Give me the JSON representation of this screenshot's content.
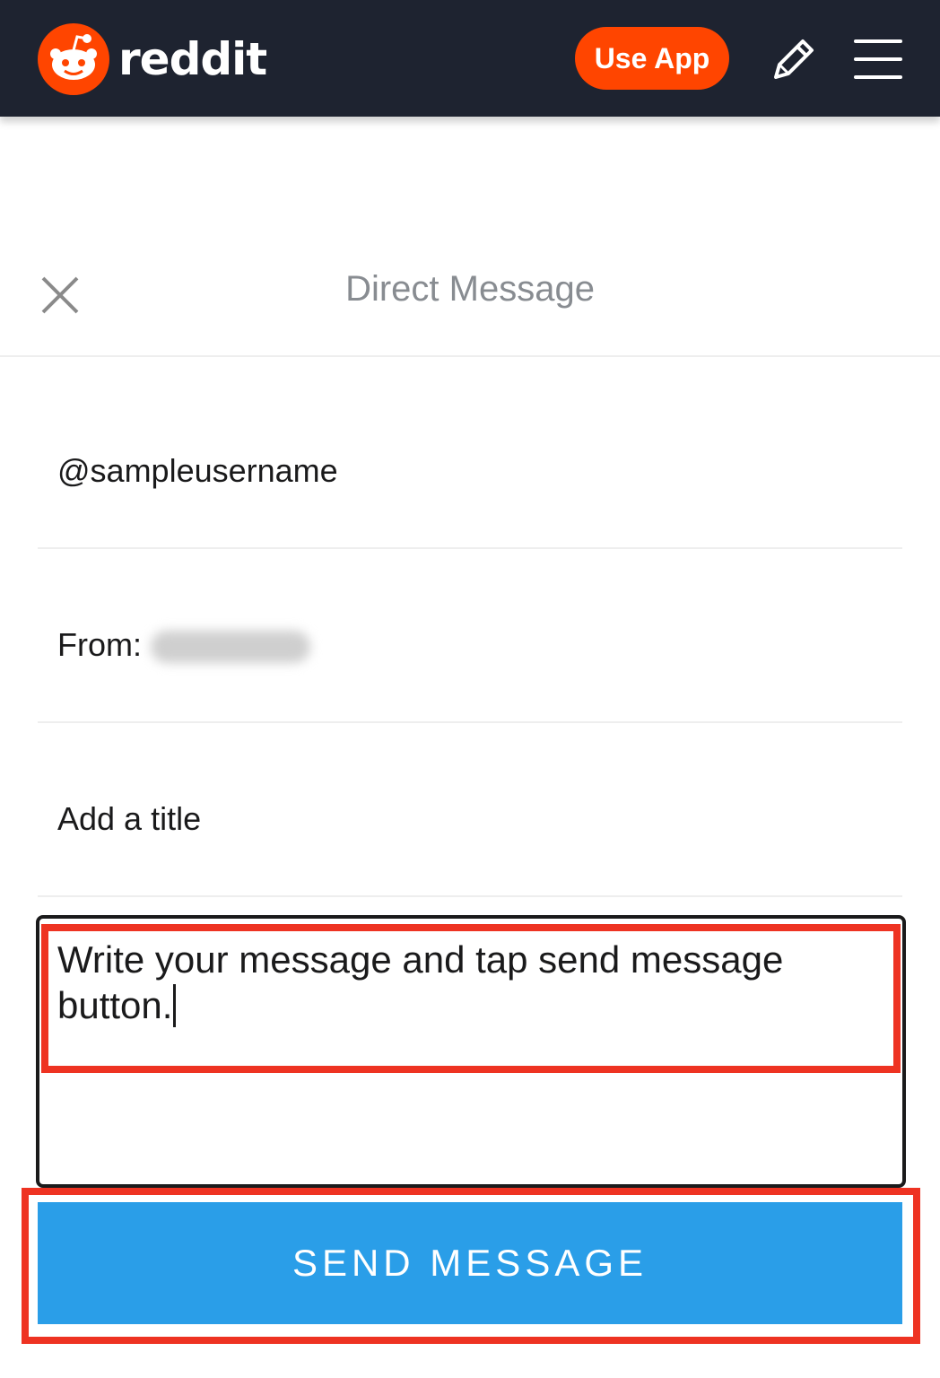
{
  "header": {
    "logo_text": "reddit",
    "use_app_label": "Use App",
    "brand_color": "#ff4500",
    "bar_color": "#1e2330",
    "icons": [
      "reddit-snoo-icon",
      "pencil-icon",
      "hamburger-menu-icon"
    ]
  },
  "dialog": {
    "title": "Direct Message",
    "close_icon": "close-icon",
    "to_value": "@sampleusername",
    "from_label": "From:",
    "title_placeholder": "Add a title",
    "message_value": "Write your message and tap send message button.",
    "send_label": "SEND MESSAGE",
    "send_color": "#2a9ee8",
    "highlight_color": "#ee3322"
  }
}
